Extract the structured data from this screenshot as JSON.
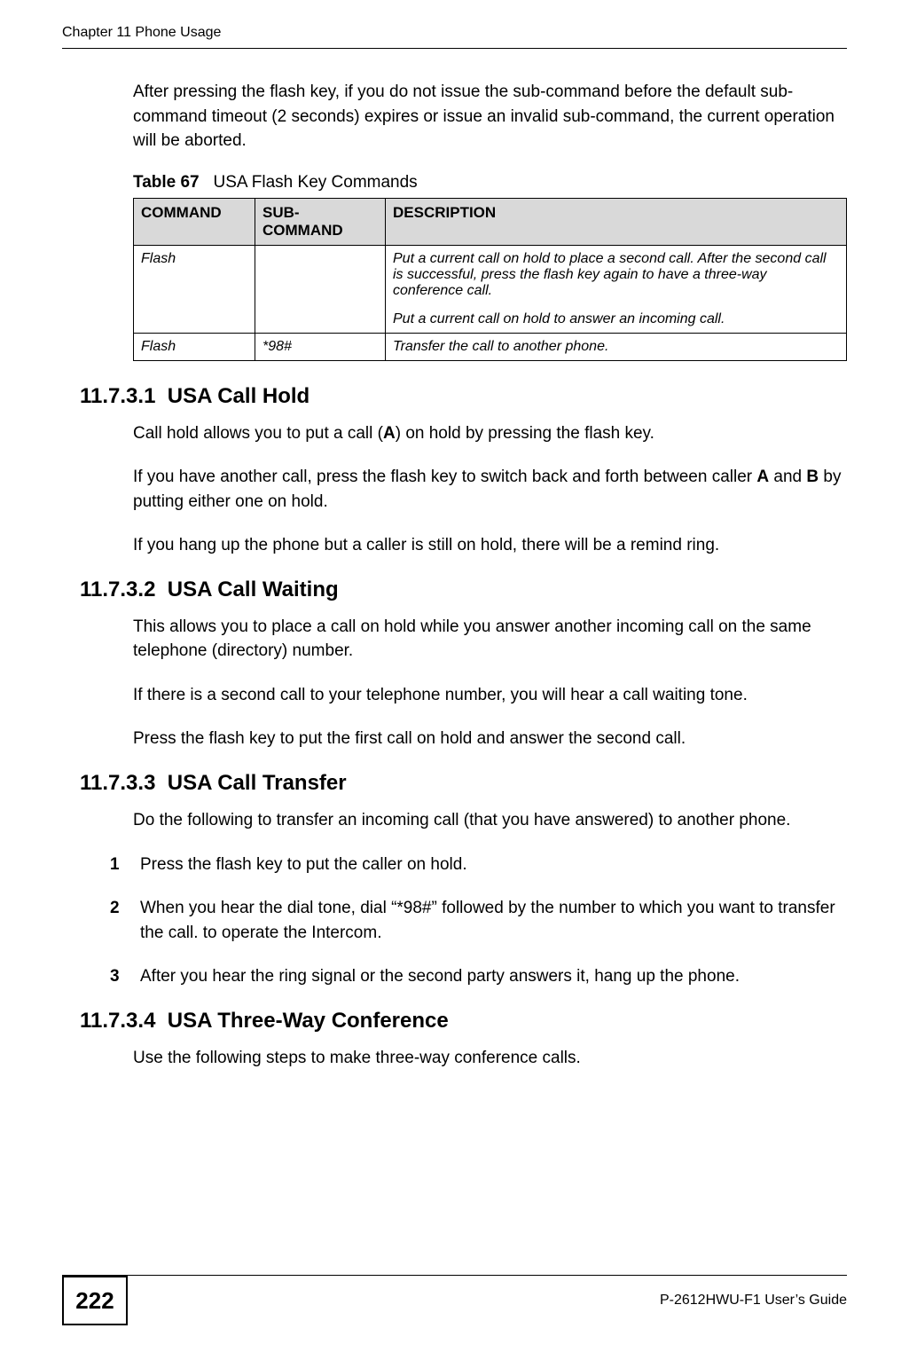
{
  "header": {
    "chapter": "Chapter 11 Phone Usage"
  },
  "intro": "After pressing the flash key, if you do not issue the sub-command before the default sub-command timeout (2 seconds) expires or issue an invalid sub-command, the current operation will be aborted.",
  "table": {
    "caption_label": "Table 67",
    "caption_text": "USA Flash Key Commands",
    "headers": {
      "c1": "COMMAND",
      "c2": "SUB-COMMAND",
      "c3": "DESCRIPTION"
    },
    "rows": [
      {
        "command": "Flash",
        "sub": "",
        "desc": "Put a current call on hold to place a second call. After the second call is successful, press the flash key again to have a three-way conference call.",
        "desc2": "Put a current call on hold to answer an incoming call."
      },
      {
        "command": "Flash",
        "sub": "*98#",
        "desc": "Transfer the call to another phone.",
        "desc2": ""
      }
    ]
  },
  "s1": {
    "num": "11.7.3.1",
    "title": "USA Call Hold",
    "p1a": "Call hold allows you to put a call (",
    "p1bold": "A",
    "p1b": ") on hold by pressing the flash key.",
    "p2a": "If you have another call, press the flash key  to switch back and forth between caller ",
    "p2boldA": "A",
    "p2mid": " and ",
    "p2boldB": "B",
    "p2b": " by putting either one on hold.",
    "p3": "If you hang up the phone but a caller is still on hold, there will be a remind ring."
  },
  "s2": {
    "num": "11.7.3.2",
    "title": "USA Call Waiting",
    "p1": "This allows you to place a call on hold while you answer another incoming call on the same telephone (directory) number.",
    "p2": "If there is a second call to your telephone number, you will hear a call waiting tone.",
    "p3": "Press the flash key to put the first call on hold and answer the second call."
  },
  "s3": {
    "num": "11.7.3.3",
    "title": "USA Call Transfer",
    "p1": "Do the following to transfer an incoming call (that you have answered) to another phone.",
    "steps": [
      "Press the flash key to put the caller on hold.",
      "When you hear the dial tone, dial “*98#” followed by the number to which you want to transfer the call. to operate the Intercom.",
      "After you hear the ring signal or the second party answers it, hang up the phone."
    ]
  },
  "s4": {
    "num": "11.7.3.4",
    "title": "USA Three-Way Conference",
    "p1": "Use the following steps to make three-way conference calls."
  },
  "footer": {
    "page": "222",
    "guide": "P-2612HWU-F1 User’s Guide"
  }
}
